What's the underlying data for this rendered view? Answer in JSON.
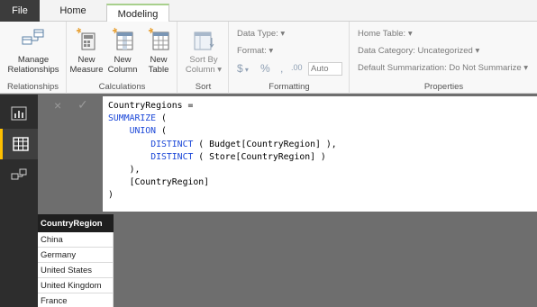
{
  "tabs": {
    "file": "File",
    "home": "Home",
    "modeling": "Modeling"
  },
  "ribbon": {
    "relationships": {
      "manage_line1": "Manage",
      "manage_line2": "Relationships",
      "group": "Relationships"
    },
    "calculations": {
      "new_measure_1": "New",
      "new_measure_2": "Measure",
      "new_column_1": "New",
      "new_column_2": "Column",
      "new_table_1": "New",
      "new_table_2": "Table",
      "group": "Calculations"
    },
    "sort": {
      "line1": "Sort By",
      "line2": "Column",
      "group": "Sort"
    },
    "formatting": {
      "data_type": "Data Type:",
      "format": "Format:",
      "currency": "$",
      "percent": "%",
      "comma": ",",
      "auto": "Auto",
      "group": "Formatting"
    },
    "properties": {
      "home_table": "Home Table:",
      "data_category": "Data Category: Uncategorized",
      "default_summarization": "Default Summarization: Do Not Summarize",
      "group": "Properties"
    }
  },
  "formula_bar": {
    "cancel": "×",
    "commit": "✓",
    "lines": [
      {
        "indent": "",
        "parts": [
          {
            "t": "CountryRegions =",
            "kw": false
          }
        ]
      },
      {
        "indent": "",
        "parts": [
          {
            "t": "SUMMARIZE",
            "kw": true
          },
          {
            "t": " (",
            "kw": false
          }
        ]
      },
      {
        "indent": "    ",
        "parts": [
          {
            "t": "UNION",
            "kw": true
          },
          {
            "t": " (",
            "kw": false
          }
        ]
      },
      {
        "indent": "        ",
        "parts": [
          {
            "t": "DISTINCT",
            "kw": true
          },
          {
            "t": " ( Budget[CountryRegion] ),",
            "kw": false
          }
        ]
      },
      {
        "indent": "        ",
        "parts": [
          {
            "t": "DISTINCT",
            "kw": true
          },
          {
            "t": " ( Store[CountryRegion] )",
            "kw": false
          }
        ]
      },
      {
        "indent": "    ",
        "parts": [
          {
            "t": "),",
            "kw": false
          }
        ]
      },
      {
        "indent": "    ",
        "parts": [
          {
            "t": "[CountryRegion]",
            "kw": false
          }
        ]
      },
      {
        "indent": "",
        "parts": [
          {
            "t": ")",
            "kw": false
          }
        ]
      }
    ]
  },
  "table": {
    "header": "CountryRegion",
    "rows": [
      "China",
      "Germany",
      "United States",
      "United Kingdom",
      "France"
    ]
  },
  "colors": {
    "accent": "#ffc000",
    "keyword": "#1c48d8",
    "tab_highlight": "#a8d08d"
  },
  "icons": {
    "nav": [
      "report-view-icon",
      "data-view-icon",
      "relationships-view-icon"
    ]
  }
}
